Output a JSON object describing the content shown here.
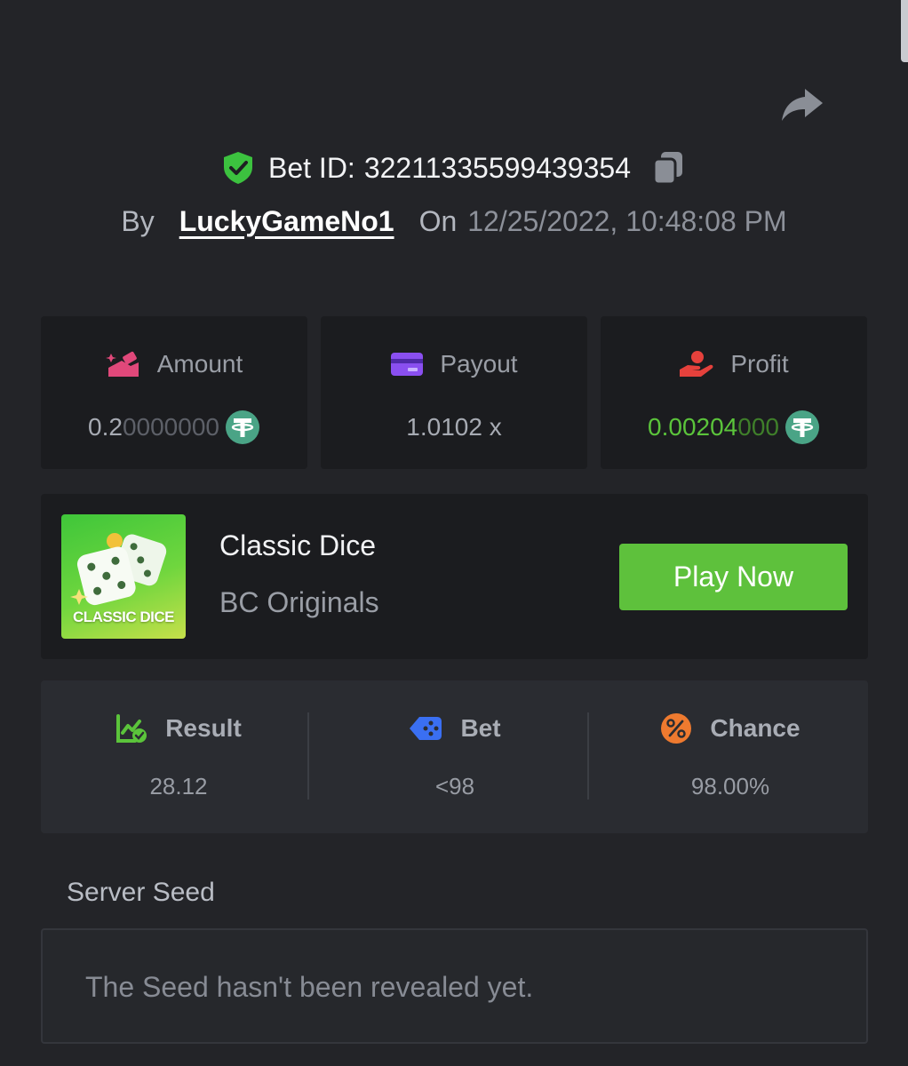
{
  "header": {
    "bet_id_label": "Bet ID:",
    "bet_id": "32211335599439354",
    "by_label": "By",
    "username": "LuckyGameNo1",
    "on_label": "On",
    "datetime": "12/25/2022, 10:48:08 PM"
  },
  "stats": {
    "amount": {
      "label": "Amount",
      "value_main": "0.2",
      "value_dim": "0000000",
      "currency_icon": "tether-icon"
    },
    "payout": {
      "label": "Payout",
      "value": "1.0102 x"
    },
    "profit": {
      "label": "Profit",
      "value_main": "0.00204",
      "value_dim": "000",
      "currency_icon": "tether-icon"
    }
  },
  "game": {
    "name": "Classic Dice",
    "provider": "BC Originals",
    "thumbnail_text": "CLASSIC DICE",
    "play_label": "Play Now"
  },
  "results": {
    "result": {
      "label": "Result",
      "value": "28.12"
    },
    "bet": {
      "label": "Bet",
      "value": "<98"
    },
    "chance": {
      "label": "Chance",
      "value": "98.00%"
    }
  },
  "server_seed": {
    "label": "Server Seed",
    "text": "The Seed hasn't been revealed yet."
  },
  "colors": {
    "background": "#232428",
    "card": "#1b1c1f",
    "accent_green": "#5ec13c",
    "tether_green": "#4aa486"
  }
}
